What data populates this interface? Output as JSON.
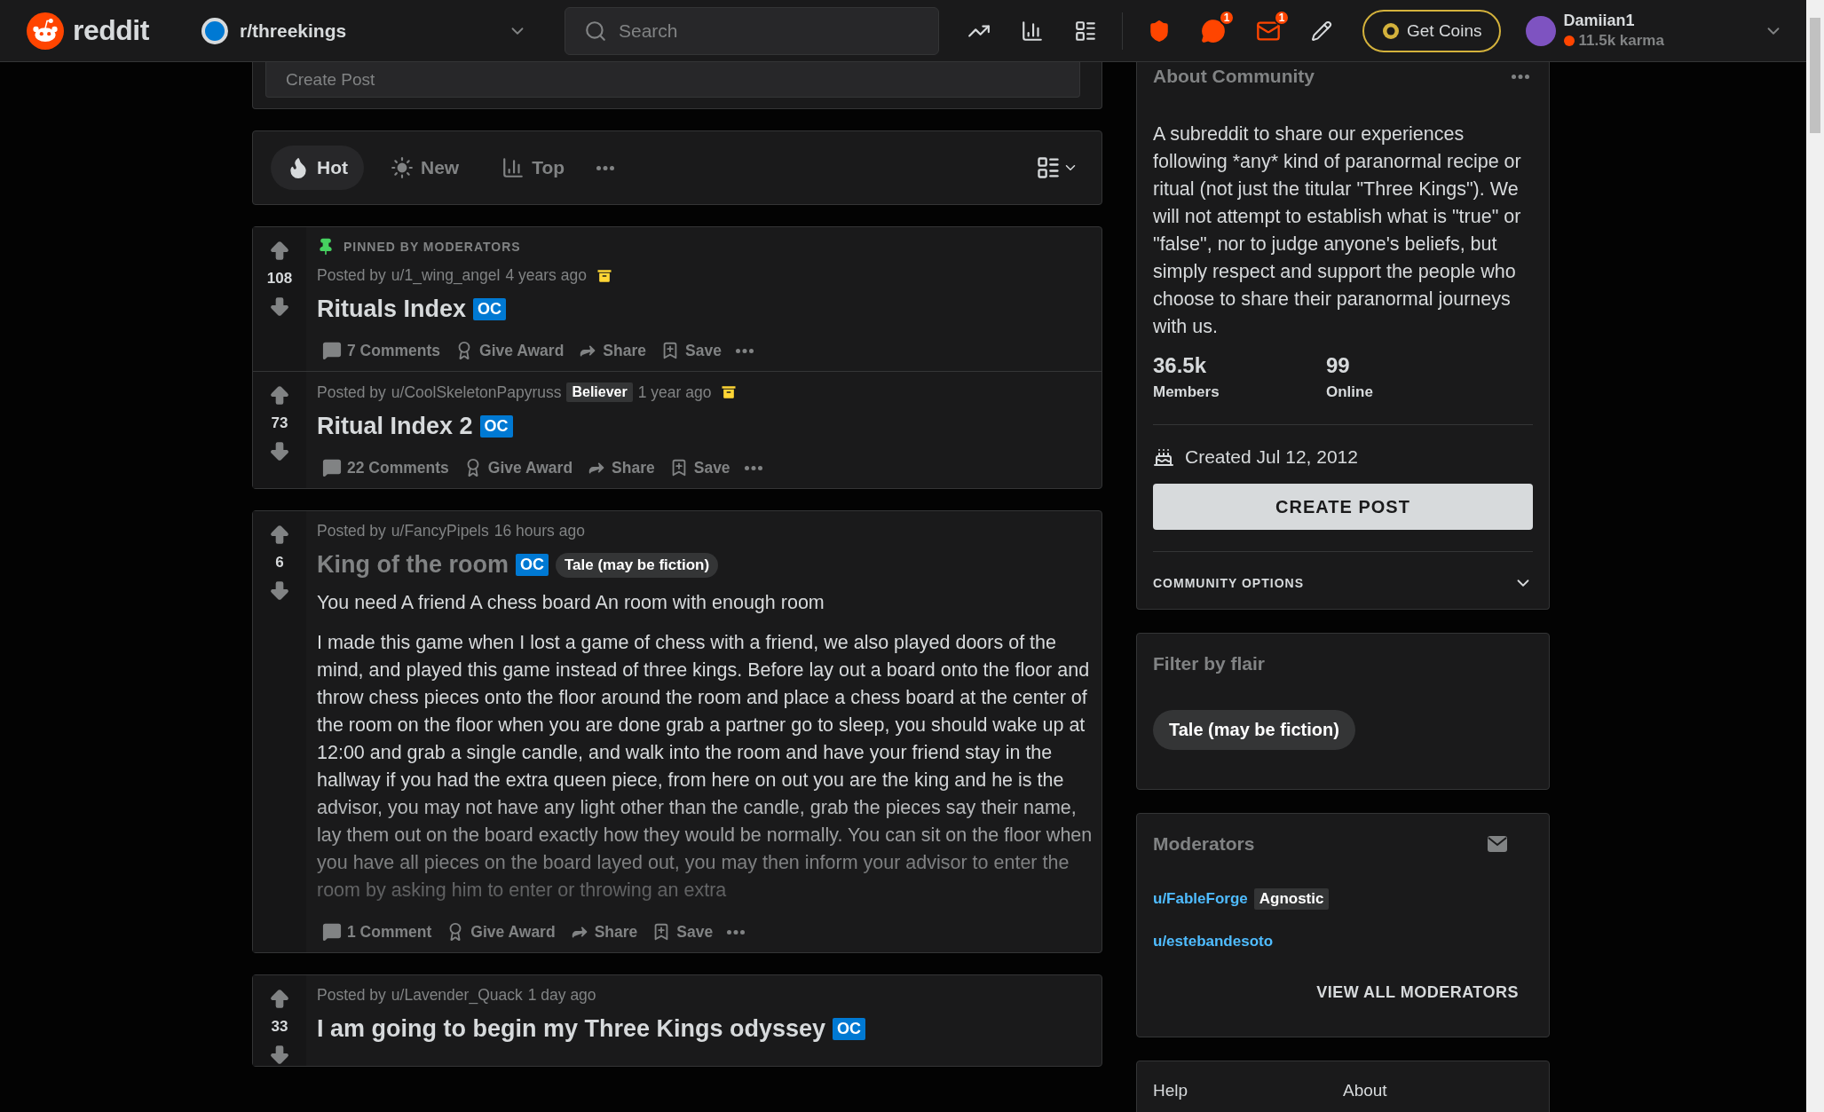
{
  "header": {
    "logo": "reddit",
    "community": "r/threekings",
    "search": {
      "placeholder": "Search"
    },
    "chat_count": "1",
    "mail_count": "1",
    "coins_button": "Get Coins",
    "user": {
      "name": "Damiian1",
      "karma": "11.5k karma"
    }
  },
  "create_post": {
    "placeholder": "Create Post"
  },
  "sort_tabs": [
    {
      "label": "Hot",
      "kind": "hot",
      "selected": true
    },
    {
      "label": "New",
      "kind": "new",
      "selected": false
    },
    {
      "label": "Top",
      "kind": "top",
      "selected": false
    }
  ],
  "pinned_posts": [
    {
      "pinned_label": "PINNED BY MODERATORS",
      "votes": "108",
      "posted_by": "Posted by",
      "author": "u/1_wing_angel",
      "time": "4 years ago",
      "archived": true,
      "title": "Rituals Index",
      "visited": false,
      "oc": "OC",
      "comments": "7 Comments",
      "actions": [
        "Give Award",
        "Share",
        "Save"
      ]
    },
    {
      "votes": "73",
      "posted_by": "Posted by",
      "author": "u/CoolSkeletonPapyruss",
      "user_flair": "Believer",
      "time": "1 year ago",
      "archived": true,
      "title": "Ritual Index 2",
      "visited": false,
      "oc": "OC",
      "comments": "22 Comments",
      "actions": [
        "Give Award",
        "Share",
        "Save"
      ]
    }
  ],
  "posts": [
    {
      "votes": "6",
      "posted_by": "Posted by",
      "author": "u/FancyPipels",
      "time": "16 hours ago",
      "title": "King of the room",
      "visited": true,
      "oc": "OC",
      "flair": "Tale (may be fiction)",
      "body": [
        "You need A friend A chess board An room with enough room",
        "I made this game when I lost a game of chess with a friend, we also played doors of the mind, and played this game instead of three kings. Before lay out a board onto the floor and throw chess pieces onto the floor around the room and place a chess board at the center of the room on the floor when you are done grab a partner go to sleep, you should wake up at 12:00 and grab a single candle, and walk into the room and have your friend stay in the hallway if you had the extra queen piece, from here on out you are the king and he is the advisor, you may not have any light other than the candle, grab the pieces say their name, lay them out on the board exactly how they would be normally. You can sit on the floor when you have all pieces on the board layed out, you may then inform your advisor to enter the room by asking him to enter or throwing an extra"
      ],
      "comments": "1 Comment",
      "actions": [
        "Give Award",
        "Share",
        "Save"
      ]
    },
    {
      "votes": "33",
      "posted_by": "Posted by",
      "author": "u/Lavender_Quack",
      "time": "1 day ago",
      "title": "I am going to begin my Three Kings odyssey",
      "visited": false,
      "oc": "OC"
    }
  ],
  "sidebar": {
    "about": {
      "title": "About Community",
      "description": "A subreddit to share our experiences following *any* kind of paranormal recipe or ritual (not just the titular \"Three Kings\"). We will not attempt to establish what is \"true\" or \"false\", nor to judge anyone's beliefs, but simply respect and support the people who choose to share their paranormal journeys with us.",
      "stats": [
        {
          "value": "36.5k",
          "label": "Members"
        },
        {
          "value": "99",
          "label": "Online"
        }
      ],
      "created": "Created Jul 12, 2012",
      "create_button": "CREATE POST",
      "options": "COMMUNITY OPTIONS",
      "options_expanded": false
    },
    "filter": {
      "title": "Filter by flair",
      "flairs": [
        "Tale (may be fiction)"
      ]
    },
    "moderators": {
      "title": "Moderators",
      "list": [
        {
          "name": "u/FableForge",
          "flair": "Agnostic"
        },
        {
          "name": "u/estebandesoto"
        }
      ],
      "view_all": "VIEW ALL MODERATORS"
    },
    "footer": {
      "links": [
        "Help",
        "About"
      ]
    }
  }
}
